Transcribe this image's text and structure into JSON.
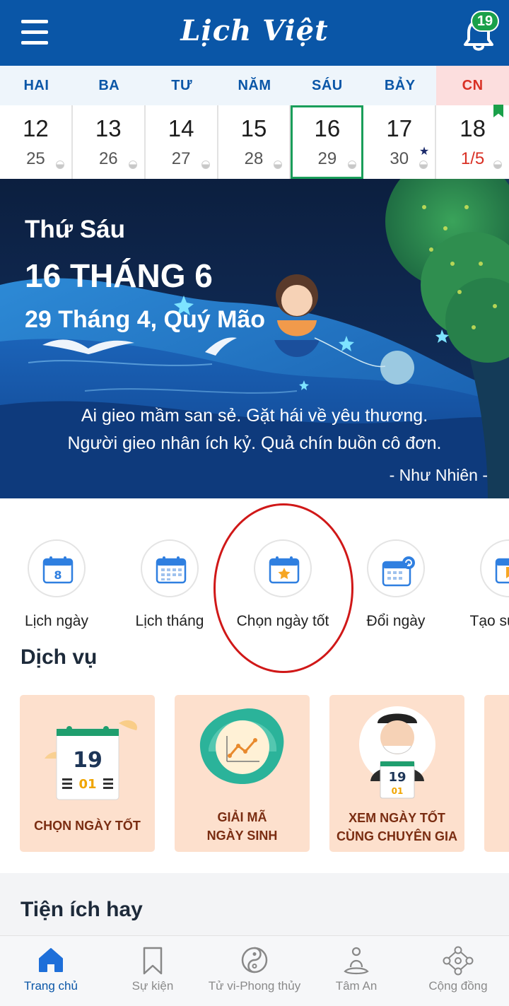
{
  "header": {
    "app_title": "Lịch Việt",
    "notification_count": "19",
    "menu_icon": "hamburger-menu-icon",
    "bell_icon": "bell-icon"
  },
  "week": {
    "weekdays": [
      "HAI",
      "BA",
      "TƯ",
      "NĂM",
      "SÁU",
      "BẢY",
      "CN"
    ],
    "days": [
      {
        "solar": "12",
        "lunar": "25"
      },
      {
        "solar": "13",
        "lunar": "26"
      },
      {
        "solar": "14",
        "lunar": "27"
      },
      {
        "solar": "15",
        "lunar": "28"
      },
      {
        "solar": "16",
        "lunar": "29"
      },
      {
        "solar": "17",
        "lunar": "30"
      },
      {
        "solar": "18",
        "lunar": "1/5"
      }
    ],
    "selected_day": "16"
  },
  "hero": {
    "day_of_week": "Thứ Sáu",
    "date": "16 THÁNG 6",
    "lunar_date": "29 Tháng 4, Quý Mão",
    "quote_line1": "Ai gieo mầm san sẻ. Gặt hái về yêu thương.",
    "quote_line2": "Người gieo nhân ích kỷ. Quả chín buồn cô đơn.",
    "author": "- Như Nhiên -"
  },
  "quick_actions": [
    {
      "label": "Lịch ngày",
      "icon": "day-calendar-icon"
    },
    {
      "label": "Lịch tháng",
      "icon": "month-calendar-icon"
    },
    {
      "label": "Chọn ngày tốt",
      "icon": "star-calendar-icon"
    },
    {
      "label": "Đổi ngày",
      "icon": "convert-date-icon"
    },
    {
      "label": "Tạo sự kiện",
      "icon": "bookmark-calendar-icon"
    }
  ],
  "services": {
    "title": "Dịch vụ",
    "items": [
      {
        "label_line1": "CHỌN NGÀY TỐT",
        "label_line2": "",
        "art_day": "19",
        "art_month": "01"
      },
      {
        "label_line1": "GIẢI MÃ",
        "label_line2": "NGÀY SINH"
      },
      {
        "label_line1": "XEM NGÀY TỐT",
        "label_line2": "CÙNG CHUYÊN GIA",
        "art_day": "19",
        "art_month": "01"
      }
    ]
  },
  "utilities": {
    "title": "Tiện ích hay"
  },
  "bottom_nav": [
    {
      "label": "Trang chủ",
      "icon": "home-icon",
      "active": true
    },
    {
      "label": "Sự kiện",
      "icon": "bookmark-icon"
    },
    {
      "label": "Tử vi-Phong thủy",
      "icon": "yin-yang-icon"
    },
    {
      "label": "Tâm An",
      "icon": "meditation-icon"
    },
    {
      "label": "Cộng đồng",
      "icon": "community-network-icon"
    }
  ],
  "colors": {
    "primary": "#0a56a7",
    "selected_border": "#1a9e5a",
    "sunday": "#d93025",
    "service_card": "#fde0cd",
    "highlight_ring": "#d01818"
  }
}
